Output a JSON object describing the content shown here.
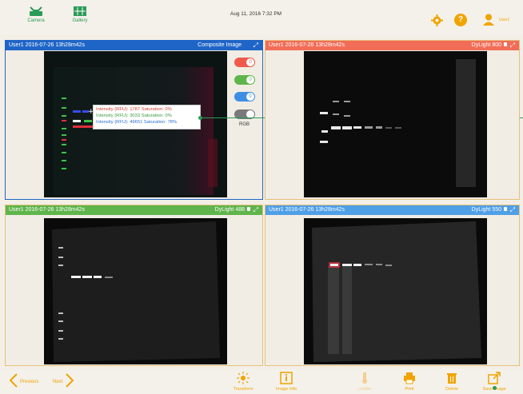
{
  "topbar": {
    "camera_label": "Camera",
    "gallery_label": "Gallery",
    "datetime": "Aug 11, 2016   7:32 PM",
    "help_label": "?",
    "user_label": "User1"
  },
  "panels": {
    "composite": {
      "title": "User1 2016-07-26 13h28m42s",
      "channel": "Composite Image",
      "color": "#1f65c7"
    },
    "dylight800": {
      "title": "User1 2016-07-26 13h28m42s",
      "channel": "DyLight 800",
      "color": "#f26d58"
    },
    "dylight488": {
      "title": "User1 2016-07-26 13h28m42s",
      "channel": "DyLight 488",
      "color": "#5fb54c"
    },
    "dylight550": {
      "title": "User1 2016-07-26 13h28m42s",
      "channel": "DyLight 550",
      "color": "#4f9fe6"
    }
  },
  "toggles": {
    "rgb_label": "RGB"
  },
  "tooltip": {
    "lines": [
      "Intensity (RFU):    1787  Saturation:       0%",
      "Intensity (RFU):    3033  Saturation:       0%",
      "Intensity (RFU):  49651  Saturation:     78%"
    ]
  },
  "bottombar": {
    "previous": "Previous",
    "next": "Next",
    "transform": "Transform",
    "image_info": "Image Info",
    "tool_disabled": "Ladder",
    "print": "Print",
    "delete": "Delete",
    "save_image": "Save Image"
  },
  "colors": {
    "accent": "#f0a400",
    "green": "#2a9a57"
  }
}
